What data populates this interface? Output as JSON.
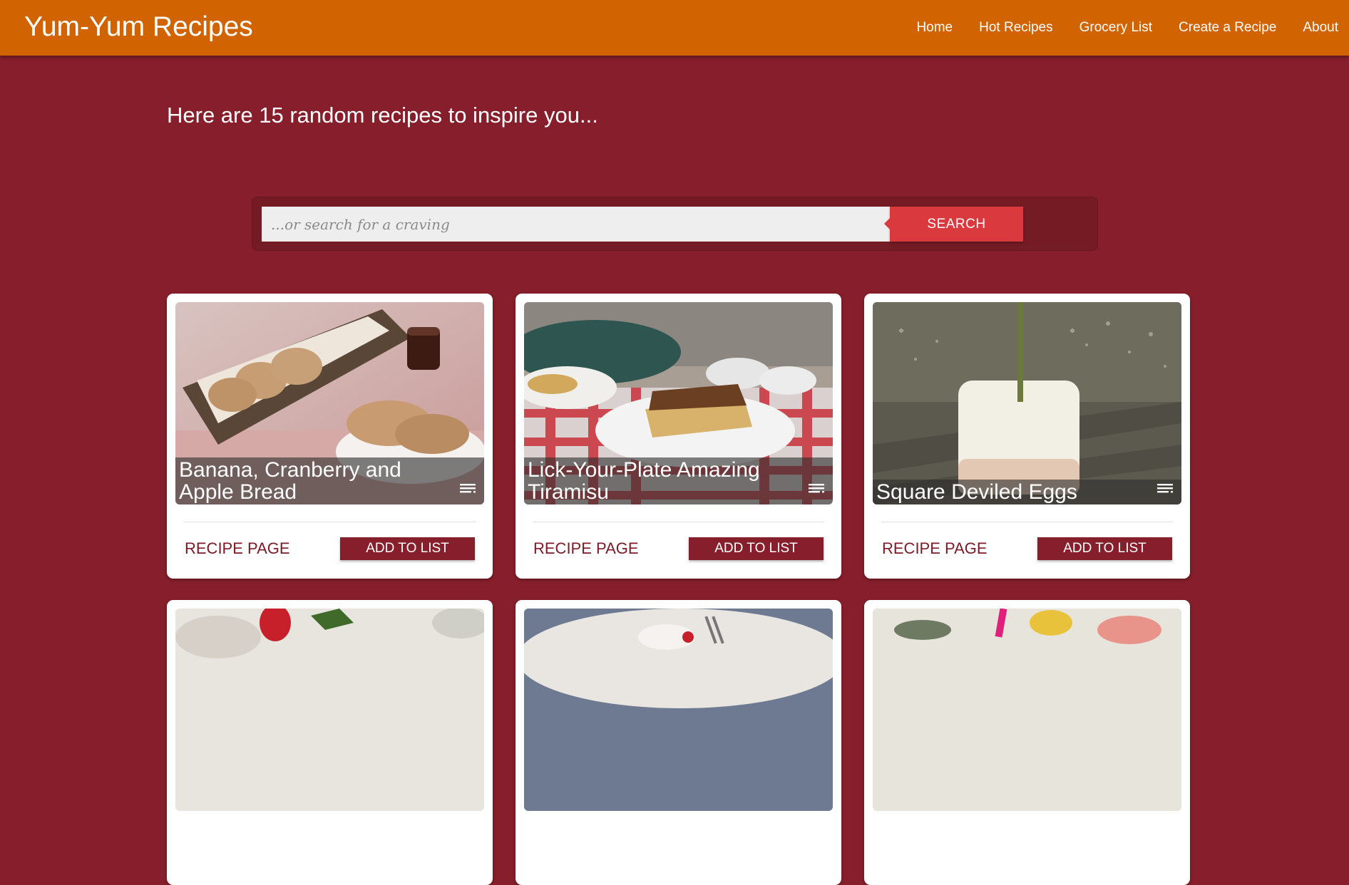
{
  "app": {
    "brand": "Yum-Yum Recipes"
  },
  "nav": {
    "items": [
      {
        "label": "Home"
      },
      {
        "label": "Hot Recipes"
      },
      {
        "label": "Grocery List"
      },
      {
        "label": "Create a Recipe"
      },
      {
        "label": "About"
      }
    ]
  },
  "main": {
    "headline": "Here are 15 random recipes to inspire you..."
  },
  "search": {
    "placeholder": "...or search for a craving",
    "value": "",
    "button_label": "SEARCH"
  },
  "cards": [
    {
      "title": "Banana, Cranberry and Apple Bread",
      "recipe_link": "RECIPE PAGE",
      "add_label": "ADD TO LIST",
      "menu_icon": "list-menu-icon"
    },
    {
      "title": "Lick-Your-Plate Amazing Tiramisu",
      "recipe_link": "RECIPE PAGE",
      "add_label": "ADD TO LIST",
      "menu_icon": "list-menu-icon"
    },
    {
      "title": "Square Deviled Eggs",
      "recipe_link": "RECIPE PAGE",
      "add_label": "ADD TO LIST",
      "menu_icon": "list-menu-icon"
    },
    {
      "title": "",
      "recipe_link": "",
      "add_label": ""
    },
    {
      "title": "",
      "recipe_link": "",
      "add_label": ""
    },
    {
      "title": "",
      "recipe_link": "",
      "add_label": ""
    }
  ],
  "colors": {
    "background": "#861e2b",
    "navbar": "#d16400",
    "search_button": "#da3a3d",
    "add_button": "#861e2b",
    "link": "#7d1a24"
  }
}
